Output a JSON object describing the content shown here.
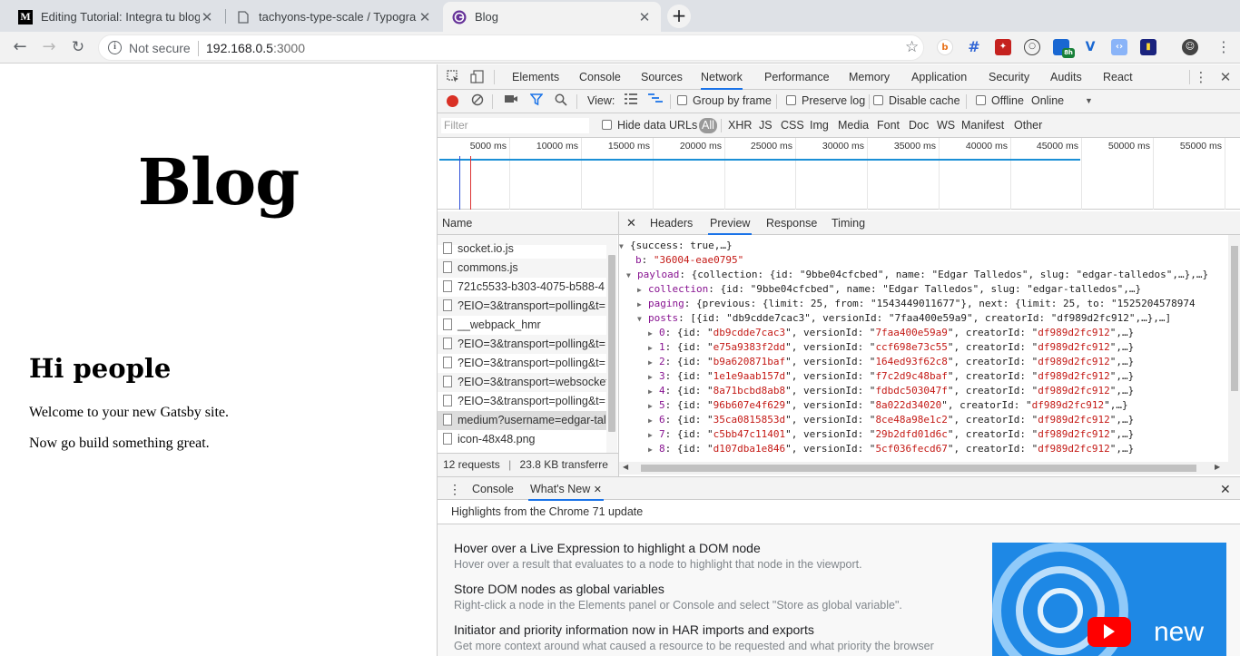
{
  "tabs": [
    {
      "title": "Editing Tutorial: Integra tu blog",
      "icon": "medium-icon"
    },
    {
      "title": "tachyons-type-scale / Typogra",
      "icon": "page-icon"
    },
    {
      "title": "Blog",
      "icon": "gatsby-icon"
    }
  ],
  "toolbar": {
    "security_label": "Not secure",
    "url_host": "192.168.0.5",
    "url_port": ":3000",
    "ext_badge": "8h"
  },
  "page": {
    "title": "Blog",
    "heading": "Hi people",
    "paragraphs": [
      "Welcome to your new Gatsby site.",
      "Now go build something great."
    ]
  },
  "devtools": {
    "tabs": [
      "Elements",
      "Console",
      "Sources",
      "Network",
      "Performance",
      "Memory",
      "Application",
      "Security",
      "Audits",
      "React"
    ],
    "active_tab": "Network",
    "network_toolbar": {
      "view_label": "View:",
      "group_by_frame": "Group by frame",
      "preserve_log": "Preserve log",
      "disable_cache": "Disable cache",
      "offline": "Offline",
      "throttle": "Online"
    },
    "filter": {
      "placeholder": "Filter",
      "hide_data_urls": "Hide data URLs",
      "types": [
        "All",
        "XHR",
        "JS",
        "CSS",
        "Img",
        "Media",
        "Font",
        "Doc",
        "WS",
        "Manifest",
        "Other"
      ]
    },
    "timeline_ticks": [
      "5000 ms",
      "10000 ms",
      "15000 ms",
      "20000 ms",
      "25000 ms",
      "30000 ms",
      "35000 ms",
      "40000 ms",
      "45000 ms",
      "50000 ms",
      "55000 ms"
    ],
    "name_header": "Name",
    "requests": [
      "socket.io.js",
      "commons.js",
      "721c5533-b303-4075-b588-4",
      "?EIO=3&transport=polling&t=",
      "__webpack_hmr",
      "?EIO=3&transport=polling&t=",
      "?EIO=3&transport=polling&t=",
      "?EIO=3&transport=websocket",
      "?EIO=3&transport=polling&t=",
      "medium?username=edgar-tal",
      "icon-48x48.png"
    ],
    "status": {
      "requests": "12 requests",
      "transferred": "23.8 KB transferre"
    },
    "detail_tabs": [
      "Headers",
      "Preview",
      "Response",
      "Timing"
    ],
    "active_detail_tab": "Preview",
    "preview": {
      "root": "{success: true,…}",
      "b_key": "b",
      "b_val": "\"36004-eae0795\"",
      "payload_key": "payload",
      "payload_val": "{collection: {id: \"9bbe04cfcbed\", name: \"Edgar Talledos\", slug: \"edgar-talledos\",…},…}",
      "collection_key": "collection",
      "collection_val": "{id: \"9bbe04cfcbed\", name: \"Edgar Talledos\", slug: \"edgar-talledos\",…}",
      "paging_key": "paging",
      "paging_val": "{previous: {limit: 25, from: \"1543449011677\"}, next: {limit: 25, to: \"1525204578974",
      "posts_key": "posts",
      "posts_val": "[{id: \"db9cdde7cac3\", versionId: \"7faa400e59a9\", creatorId: \"df989d2fc912\",…},…]",
      "posts": [
        {
          "i": "0",
          "id": "db9cdde7cac3",
          "ver": "7faa400e59a9"
        },
        {
          "i": "1",
          "id": "e75a9383f2dd",
          "ver": "ccf698e73c55"
        },
        {
          "i": "2",
          "id": "b9a620871baf",
          "ver": "164ed93f62c8"
        },
        {
          "i": "3",
          "id": "1e1e9aab157d",
          "ver": "f7c2d9c48baf"
        },
        {
          "i": "4",
          "id": "8a71bcbd8ab8",
          "ver": "fdbdc503047f"
        },
        {
          "i": "5",
          "id": "96b607e4f629",
          "ver": "8a022d34020"
        },
        {
          "i": "6",
          "id": "35ca0815853d",
          "ver": "8ce48a98e1c2"
        },
        {
          "i": "7",
          "id": "c5bb47c11401",
          "ver": "29b2dfd01d6c"
        },
        {
          "i": "8",
          "id": "d107dba1e846",
          "ver": "5cf036fecd67"
        }
      ],
      "creator": "df989d2fc912"
    },
    "drawer": {
      "tabs": [
        "Console",
        "What's New"
      ],
      "active": "What's New",
      "subtitle": "Highlights from the Chrome 71 update",
      "items": [
        {
          "title": "Hover over a Live Expression to highlight a DOM node",
          "desc": "Hover over a result that evaluates to a node to highlight that node in the viewport."
        },
        {
          "title": "Store DOM nodes as global variables",
          "desc": "Right-click a node in the Elements panel or Console and select \"Store as global variable\"."
        },
        {
          "title": "Initiator and priority information now in HAR imports and exports",
          "desc": "Get more context around what caused a resource to be requested and what priority the browser"
        }
      ],
      "video_label": "new"
    }
  },
  "colors": {
    "accent": "#1a73e8",
    "record": "#d93025",
    "tabstrip": "#dee1e6"
  }
}
